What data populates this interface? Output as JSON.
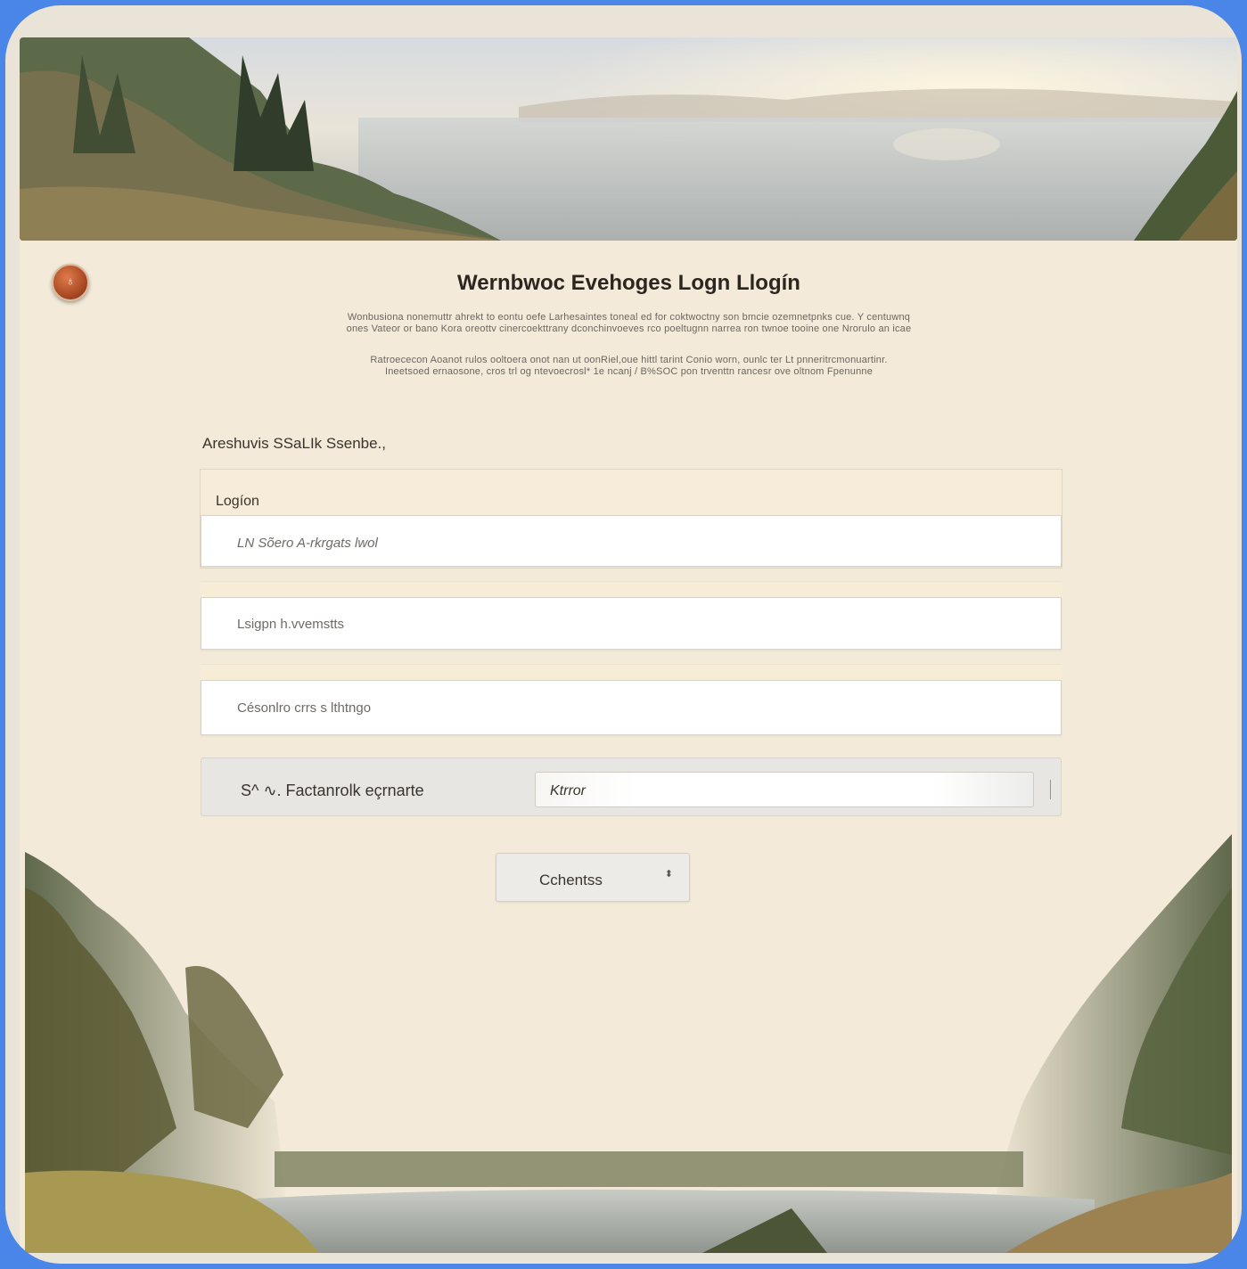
{
  "page": {
    "title": "Wernbwoc Evehoges Logn Llogín",
    "description_1_line_1": "Wonbusiona nonemuttr ahrekt to eontu oefe Larhesaintes toneal ed for coktwoctny son bmcie ozemnetpnks cue. Y centuwnq",
    "description_1_line_2": "ones Vateor or bano Kora oreottv cinercoekttrany dconchinvoeves rco poeltugnn narrea ron twnoe tooine one Nrorulo an icae",
    "description_2_line_1": "Ratroececon Aoanot rulos ooltoera onot nan ut oonRiel,oue hittl tarint Conio worn, ounlc ter Lt pnneritrcmonuartinr.",
    "description_2_line_2": "Ineetsoed ernaosone, cros trl og ntevoecrosl* 1e ncanj / B%SOC     pon trventtn rancesr ove oltnom Fpenunne"
  },
  "logo": {
    "icon": "badge-icon",
    "glyph": "♁",
    "color": "#a1431f"
  },
  "form": {
    "section_label": "Areshuvis SSaLIk Ssenbe.,",
    "login_group_label": "Logíon",
    "username_placeholder": "LN Sõero A-rkrgats lwol",
    "password_placeholder": "Lsigpn h.vvemstts",
    "confirm_placeholder": "Césonlro crrs s lthtngo",
    "remember_label": "S^ ∿. Factanrolk eçrnarte",
    "select_value": "Ktrror",
    "submit_label": "Cchentss",
    "submit_arrow": "⬍"
  },
  "colors": {
    "frame": "#4a86e8",
    "panel": "#f3ead9",
    "field": "#ffffff"
  }
}
